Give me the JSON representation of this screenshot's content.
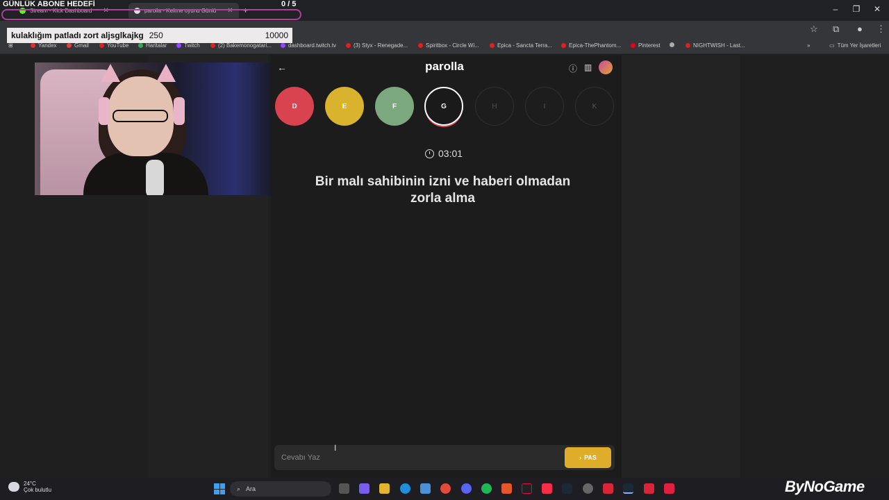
{
  "overlay": {
    "goal_title": "GÜNLÜK ABONE HEDEFİ",
    "goal_count": "0  / 5",
    "sub_text": "kulaklığım patladı zort aljsglkajkg",
    "sub_amount": "250",
    "sub_target": "10000"
  },
  "browser": {
    "tabs": [
      {
        "label": "Stream - Kick Dashboard"
      },
      {
        "label": "parolla - Kelime oyunu Günlü"
      }
    ],
    "bookmarks": [
      {
        "label": "Yandex",
        "color": "#e03030"
      },
      {
        "label": "Gmail",
        "color": "#e04040"
      },
      {
        "label": "YouTube",
        "color": "#e02020"
      },
      {
        "label": "Haritalar",
        "color": "#34a853"
      },
      {
        "label": "Twitch",
        "color": "#9146ff"
      },
      {
        "label": "(2) Bakemonogatari...",
        "color": "#e02020"
      },
      {
        "label": "dashboard.twitch.tv",
        "color": "#9146ff"
      },
      {
        "label": "(3) Styx - Renegade...",
        "color": "#e02020"
      },
      {
        "label": "Spiritbox - Circle Wi...",
        "color": "#e02020"
      },
      {
        "label": "Epica - Sancta Terra...",
        "color": "#e02020"
      },
      {
        "label": "Epica-ThePhantom...",
        "color": "#e02020"
      },
      {
        "label": "Pinterest",
        "color": "#e60023"
      },
      {
        "label": "",
        "color": "#aaaaaa"
      },
      {
        "label": "NIGHTWISH - Last...",
        "color": "#e02020"
      }
    ],
    "all_bookmarks": "Tüm Yer İşaretleri"
  },
  "game": {
    "title": "parolla",
    "timer": "03:01",
    "question": "Bir malı sahibinin izni ve haberi olmadan zorla alma",
    "letters": [
      {
        "letter": "D",
        "state": "wrong",
        "color": "#d9434f"
      },
      {
        "letter": "E",
        "state": "passed",
        "color": "#d9b22e"
      },
      {
        "letter": "F",
        "state": "correct",
        "color": "#7ba87c"
      },
      {
        "letter": "G",
        "state": "active",
        "color": "#1a1a1a"
      },
      {
        "letter": "H",
        "state": "pending",
        "color": "#1d1d1d"
      },
      {
        "letter": "I",
        "state": "pending",
        "color": "#1d1d1d"
      },
      {
        "letter": "K",
        "state": "pending",
        "color": "#1d1d1d"
      }
    ],
    "answer_placeholder": "Cevabı Yaz",
    "pass_label": "PAS"
  },
  "taskbar": {
    "temperature": "24°C",
    "weather": "Çok bulutlu",
    "search": "Ara"
  },
  "brand": "ByNoGame"
}
